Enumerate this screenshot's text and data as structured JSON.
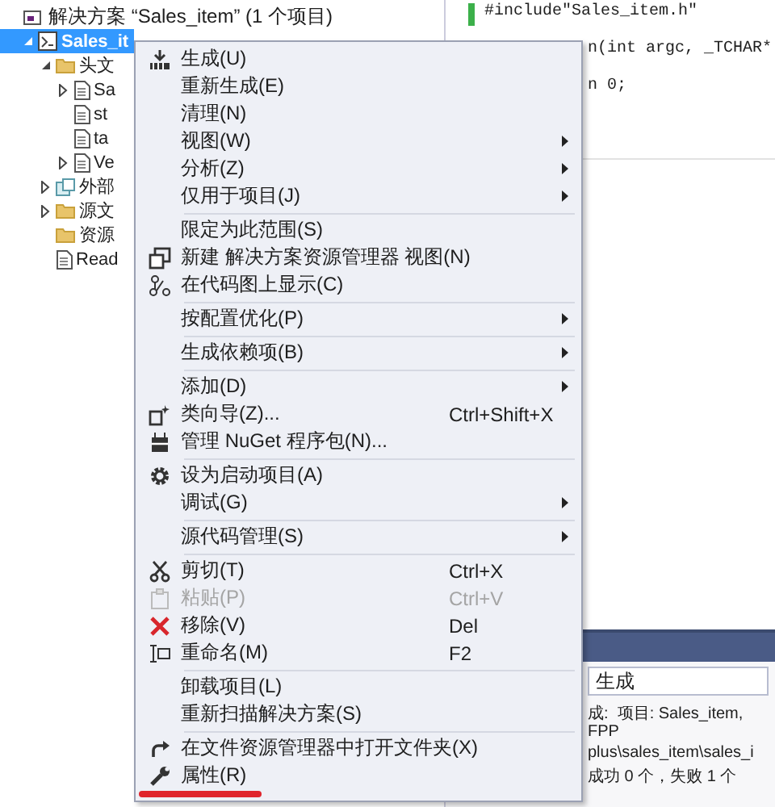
{
  "solution_explorer": {
    "tree": [
      {
        "label": "解决方案 “Sales_item” (1 个项目)",
        "kind": "solution",
        "selected": false,
        "children": [
          {
            "label": "Sales_it",
            "kind": "project",
            "selected": true,
            "expanded": true,
            "children": [
              {
                "label": "头文",
                "kind": "folder",
                "selected": false,
                "expanded": true,
                "children": [
                  {
                    "label": "Sa",
                    "kind": "file",
                    "selected": false,
                    "expanded": false
                  },
                  {
                    "label": "st",
                    "kind": "file",
                    "selected": false
                  },
                  {
                    "label": "ta",
                    "kind": "file",
                    "selected": false
                  },
                  {
                    "label": "Ve",
                    "kind": "file",
                    "selected": false,
                    "expanded": false
                  }
                ]
              },
              {
                "label": "外部",
                "kind": "references",
                "selected": false,
                "expanded": false
              },
              {
                "label": "源文",
                "kind": "folder",
                "selected": false,
                "expanded": false
              },
              {
                "label": "资源",
                "kind": "folder",
                "selected": false
              },
              {
                "label": "Read",
                "kind": "file",
                "selected": false
              }
            ]
          }
        ]
      }
    ]
  },
  "editor": {
    "lines": [
      "#include\"Sales_item.h\"",
      "n(int argc, _TCHAR*",
      "n 0;"
    ]
  },
  "output": {
    "source": "生成",
    "lines": [
      "成:  项目: Sales_item,",
      "FPP",
      "plus\\sales_item\\sales_i",
      "成功 0 个，失败 1 个"
    ]
  },
  "context_menu": {
    "items": [
      {
        "kind": "item",
        "label": "生成(U)",
        "submenu": false,
        "disabled": false
      },
      {
        "kind": "item",
        "label": "重新生成(E)",
        "submenu": false,
        "disabled": false
      },
      {
        "kind": "item",
        "label": "清理(N)",
        "submenu": false,
        "disabled": false
      },
      {
        "kind": "item",
        "label": "视图(W)",
        "submenu": true,
        "disabled": false
      },
      {
        "kind": "item",
        "label": "分析(Z)",
        "submenu": true,
        "disabled": false
      },
      {
        "kind": "item",
        "label": "仅用于项目(J)",
        "submenu": true,
        "disabled": false
      },
      {
        "kind": "separator"
      },
      {
        "kind": "item",
        "label": "限定为此范围(S)",
        "submenu": false,
        "disabled": false
      },
      {
        "kind": "item",
        "label": "新建 解决方案资源管理器 视图(N)",
        "submenu": false,
        "disabled": false
      },
      {
        "kind": "item",
        "label": "在代码图上显示(C)",
        "submenu": false,
        "disabled": false
      },
      {
        "kind": "separator"
      },
      {
        "kind": "item",
        "label": "按配置优化(P)",
        "submenu": true,
        "disabled": false
      },
      {
        "kind": "separator"
      },
      {
        "kind": "item",
        "label": "生成依赖项(B)",
        "submenu": true,
        "disabled": false
      },
      {
        "kind": "separator"
      },
      {
        "kind": "item",
        "label": "添加(D)",
        "submenu": true,
        "disabled": false
      },
      {
        "kind": "item",
        "label": "类向导(Z)...",
        "shortcut": "Ctrl+Shift+X",
        "submenu": false,
        "disabled": false
      },
      {
        "kind": "item",
        "label": "管理 NuGet 程序包(N)...",
        "submenu": false,
        "disabled": false
      },
      {
        "kind": "separator"
      },
      {
        "kind": "item",
        "label": "设为启动项目(A)",
        "submenu": false,
        "disabled": false
      },
      {
        "kind": "item",
        "label": "调试(G)",
        "submenu": true,
        "disabled": false
      },
      {
        "kind": "separator"
      },
      {
        "kind": "item",
        "label": "源代码管理(S)",
        "submenu": true,
        "disabled": false
      },
      {
        "kind": "separator"
      },
      {
        "kind": "item",
        "label": "剪切(T)",
        "shortcut": "Ctrl+X",
        "submenu": false,
        "disabled": false
      },
      {
        "kind": "item",
        "label": "粘贴(P)",
        "shortcut": "Ctrl+V",
        "submenu": false,
        "disabled": true
      },
      {
        "kind": "item",
        "label": "移除(V)",
        "shortcut": "Del",
        "submenu": false,
        "disabled": false
      },
      {
        "kind": "item",
        "label": "重命名(M)",
        "shortcut": "F2",
        "submenu": false,
        "disabled": false
      },
      {
        "kind": "separator"
      },
      {
        "kind": "item",
        "label": "卸载项目(L)",
        "submenu": false,
        "disabled": false
      },
      {
        "kind": "item",
        "label": "重新扫描解决方案(S)",
        "submenu": false,
        "disabled": false
      },
      {
        "kind": "separator"
      },
      {
        "kind": "item",
        "label": "在文件资源管理器中打开文件夹(X)",
        "submenu": false,
        "disabled": false
      },
      {
        "kind": "item",
        "label": "属性(R)",
        "submenu": false,
        "disabled": false
      }
    ]
  }
}
